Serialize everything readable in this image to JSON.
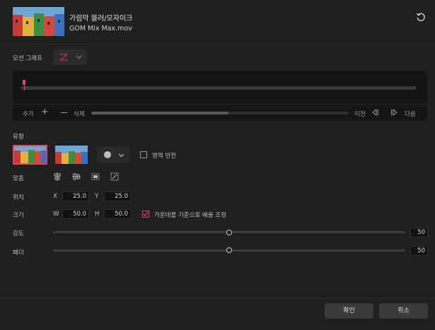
{
  "header": {
    "title": "가림막 블러/모자이크",
    "filename": "GOM Mix Max.mov"
  },
  "motion_graph": {
    "label": "모션 그래프"
  },
  "timeline": {
    "add_label": "추가",
    "delete_label": "삭제",
    "prev_label": "이전",
    "next_label": "다음"
  },
  "type_section": {
    "label": "유형",
    "invert_label": "영역 반전"
  },
  "align": {
    "label": "맞춤"
  },
  "position": {
    "label": "위치",
    "x_label": "X",
    "x_value": "25.0",
    "y_label": "Y",
    "y_value": "25.0"
  },
  "size": {
    "label": "크기",
    "w_label": "W",
    "w_value": "50.0",
    "h_label": "H",
    "h_value": "50.0",
    "center_scale_label": "가운데를 기준으로 배율 조정",
    "center_scale_checked": true
  },
  "strength": {
    "label": "강도",
    "value": "50",
    "fraction": 0.5
  },
  "feather": {
    "label": "페더",
    "value": "50",
    "fraction": 0.5
  },
  "footer": {
    "confirm_label": "확인",
    "cancel_label": "취소"
  },
  "colors": {
    "accent": "#e0455a",
    "background": "#202020"
  }
}
